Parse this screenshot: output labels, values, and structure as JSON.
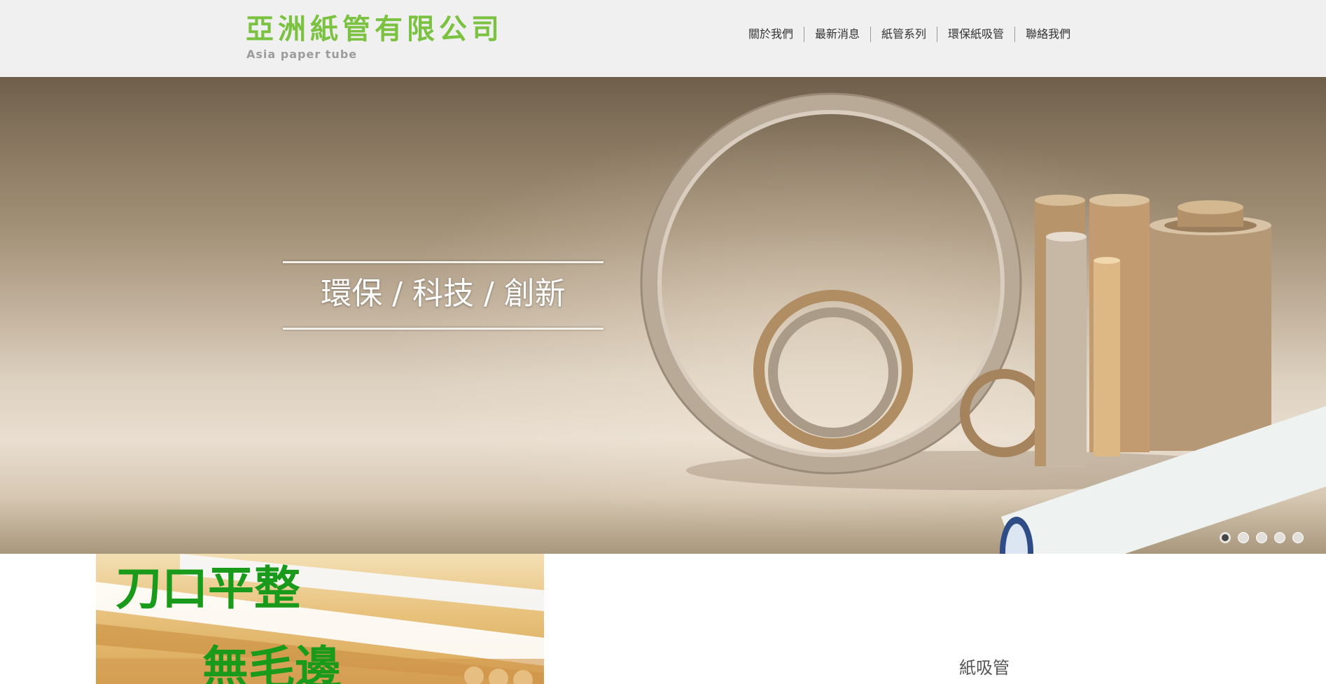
{
  "header": {
    "logo_cn": "亞洲紙管有限公司",
    "logo_en": "Asia paper tube",
    "nav": [
      {
        "label": "關於我們"
      },
      {
        "label": "最新消息"
      },
      {
        "label": "紙管系列"
      },
      {
        "label": "環保紙吸管"
      },
      {
        "label": "聯絡我們"
      }
    ]
  },
  "banner": {
    "tagline": "環保 / 科技 / 創新",
    "slides_total": 5,
    "active_slide": 1
  },
  "promo": {
    "line1": "刀口平整",
    "line2": "無毛邊"
  },
  "section": {
    "title": "紙吸管"
  },
  "colors": {
    "brand_green": "#7cc242",
    "promo_green": "#1a9a1a",
    "header_bg": "#f0f0f0"
  }
}
